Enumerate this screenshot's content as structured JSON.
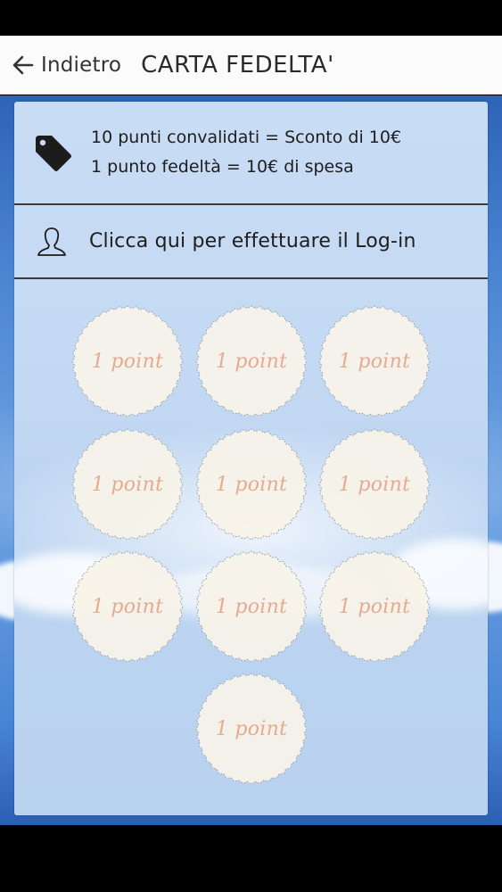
{
  "action_bar": {
    "back_label": "Indietro",
    "title": "CARTA FEDELTA'"
  },
  "info": {
    "icon": "tag-icon",
    "line1": "10 punti convalidati = Sconto di 10€",
    "line2": "1 punto fedeltà = 10€ di spesa"
  },
  "login": {
    "icon": "user-icon",
    "label": "Clicca qui per effettuare il Log-in"
  },
  "stamps": [
    {
      "label": "1 point"
    },
    {
      "label": "1 point"
    },
    {
      "label": "1 point"
    },
    {
      "label": "1 point"
    },
    {
      "label": "1 point"
    },
    {
      "label": "1 point"
    },
    {
      "label": "1 point"
    },
    {
      "label": "1 point"
    },
    {
      "label": "1 point"
    },
    {
      "label": "1 point"
    }
  ],
  "colors": {
    "action_bar_bg": "#fbfbfb",
    "background_blue": "#4b86d3",
    "card_bg": "#c4d9f3",
    "stamp_fill": "#f8f3e8",
    "stamp_text": "#e6aa90"
  }
}
